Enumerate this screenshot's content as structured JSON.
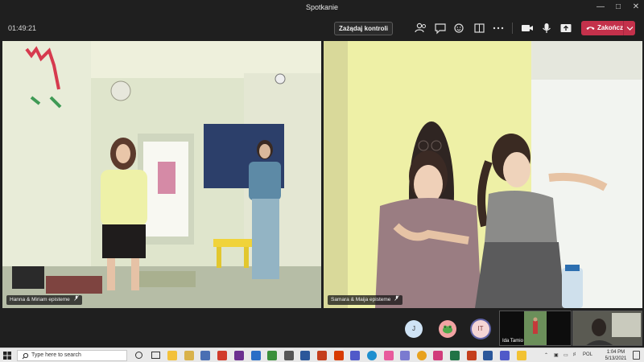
{
  "window": {
    "title": "Spotkanie"
  },
  "toolbar": {
    "timer": "01:49:21",
    "request_control_label": "Zażądaj kontroli",
    "end_call_label": "Zakończ"
  },
  "tiles": [
    {
      "label": "Hanna & Miriam episteme"
    },
    {
      "label": "Samara & Maija episteme"
    }
  ],
  "participants": [
    {
      "initials": "J",
      "color": "#cfe3f5"
    },
    {
      "initials": "",
      "color": "#f2a3a3"
    },
    {
      "initials": "IT",
      "color": "#f5d5d5"
    }
  ],
  "thumbnails": [
    {
      "label": "Ida Tamio"
    }
  ],
  "taskbar": {
    "search_placeholder": "Type here to search",
    "language": "POL",
    "time": "1:04 PM",
    "date": "5/13/2021"
  },
  "colors": {
    "end_call": "#c4314b",
    "app_bg": "#1f1f1f"
  }
}
